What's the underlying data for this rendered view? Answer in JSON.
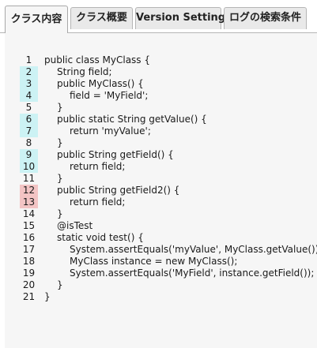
{
  "tabs": [
    {
      "label": "クラス内容",
      "active": true
    },
    {
      "label": "クラス概要",
      "active": false
    },
    {
      "label": "Version Settings",
      "active": false
    },
    {
      "label": "ログの検索条件",
      "active": false
    }
  ],
  "coverage_colors": {
    "covered": "#ccf2f4",
    "uncovered": "#f3c4c4"
  },
  "code_lines": [
    {
      "num": "1",
      "indent": 0,
      "text": "public class MyClass {",
      "cov": "none"
    },
    {
      "num": "2",
      "indent": 1,
      "text": "String field;",
      "cov": "covered"
    },
    {
      "num": "3",
      "indent": 1,
      "text": "public MyClass() {",
      "cov": "covered"
    },
    {
      "num": "4",
      "indent": 2,
      "text": "field = 'MyField';",
      "cov": "covered"
    },
    {
      "num": "5",
      "indent": 1,
      "text": "}",
      "cov": "none"
    },
    {
      "num": "6",
      "indent": 1,
      "text": "public static String getValue() {",
      "cov": "covered"
    },
    {
      "num": "7",
      "indent": 2,
      "text": "return 'myValue';",
      "cov": "covered"
    },
    {
      "num": "8",
      "indent": 1,
      "text": "}",
      "cov": "none"
    },
    {
      "num": "9",
      "indent": 1,
      "text": "public String getField() {",
      "cov": "covered"
    },
    {
      "num": "10",
      "indent": 2,
      "text": "return field;",
      "cov": "covered"
    },
    {
      "num": "11",
      "indent": 1,
      "text": "}",
      "cov": "none"
    },
    {
      "num": "12",
      "indent": 1,
      "text": "public String getField2() {",
      "cov": "uncovered"
    },
    {
      "num": "13",
      "indent": 2,
      "text": "return field;",
      "cov": "uncovered"
    },
    {
      "num": "14",
      "indent": 1,
      "text": "}",
      "cov": "none"
    },
    {
      "num": "15",
      "indent": 1,
      "text": "@isTest",
      "cov": "none"
    },
    {
      "num": "16",
      "indent": 1,
      "text": "static void test() {",
      "cov": "none"
    },
    {
      "num": "17",
      "indent": 2,
      "text": "System.assertEquals('myValue', MyClass.getValue());",
      "cov": "none"
    },
    {
      "num": "18",
      "indent": 2,
      "text": "MyClass instance = new MyClass();",
      "cov": "none"
    },
    {
      "num": "19",
      "indent": 2,
      "text": "System.assertEquals('MyField', instance.getField());",
      "cov": "none"
    },
    {
      "num": "20",
      "indent": 1,
      "text": "}",
      "cov": "none"
    },
    {
      "num": "21",
      "indent": 0,
      "text": "}",
      "cov": "none"
    }
  ]
}
